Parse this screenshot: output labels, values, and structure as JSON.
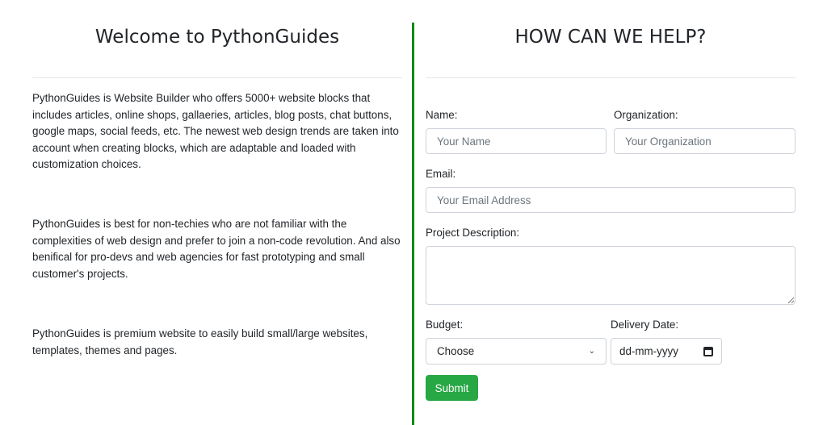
{
  "left": {
    "title": "Welcome to PythonGuides",
    "paragraphs": [
      "PythonGuides is Website Builder who offers 5000+ website blocks that includes articles, online shops, gallaeries, articles, blog posts, chat buttons, google maps, social feeds, etc. The newest web design trends are taken into account when creating blocks, which are adaptable and loaded with customization choices.",
      "PythonGuides is best for non-techies who are not familiar with the complexities of web design and prefer to join a non-code revolution. And also benifical for pro-devs and web agencies for fast prototyping and small customer's projects.",
      "PythonGuides is premium website to easily build small/large websites, templates, themes and pages."
    ]
  },
  "form": {
    "title": "HOW CAN WE HELP?",
    "name_label": "Name:",
    "name_placeholder": "Your Name",
    "org_label": "Organization:",
    "org_placeholder": "Your Organization",
    "email_label": "Email:",
    "email_placeholder": "Your Email Address",
    "description_label": "Project Description:",
    "budget_label": "Budget:",
    "budget_selected": "Choose",
    "date_label": "Delivery Date:",
    "date_placeholder": "dd-mm-yyyy",
    "submit_label": "Submit"
  },
  "colors": {
    "divider": "#0a8a0a",
    "submit_button": "#28a745"
  }
}
